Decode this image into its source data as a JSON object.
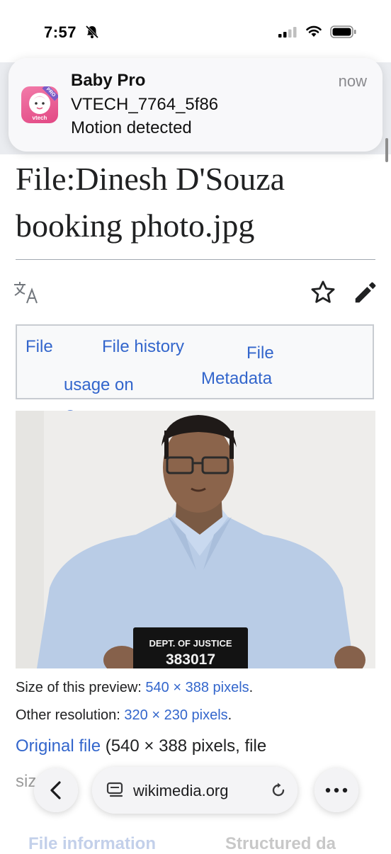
{
  "status_bar": {
    "time": "7:57"
  },
  "notification": {
    "app_name": "Baby Pro",
    "time": "now",
    "device": "VTECH_7764_5f86",
    "message": "Motion detected",
    "icon_label": "vtech",
    "icon_badge": "PRO"
  },
  "page": {
    "title": "File:Dinesh D'Souza booking photo.jpg",
    "tabs": [
      "File",
      "File history",
      "File usage on Commons",
      "Metadata"
    ]
  },
  "photo": {
    "placard_line1": "DEPT. OF JUSTICE",
    "placard_line2": "383017"
  },
  "file_info": {
    "preview_label": "Size of this preview:",
    "preview_value": "540 × 388 pixels",
    "preview_end": ".",
    "other_label": "Other resolution:",
    "other_value": "320 × 230 pixels",
    "other_end": ".",
    "original_link": "Original file",
    "original_rest": "(540 × 388 pixels, file",
    "partial_line": "siz"
  },
  "browser": {
    "url": "wikimedia.org"
  },
  "bottom_tabs": [
    "File information",
    "Structured da"
  ]
}
